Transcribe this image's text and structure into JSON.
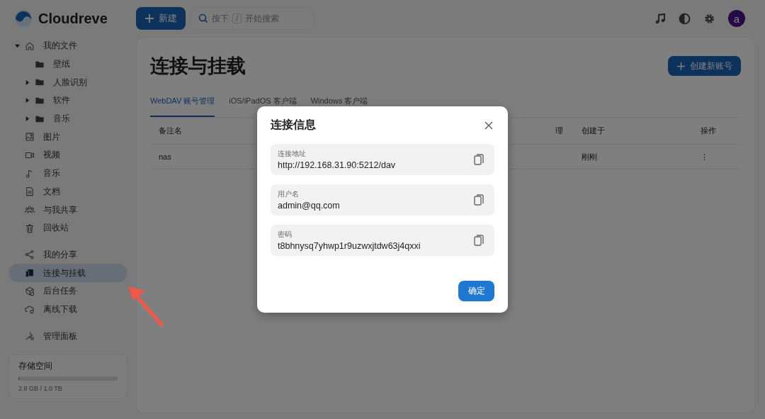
{
  "app": {
    "name": "Cloudreve"
  },
  "topbar": {
    "new_button": "新建",
    "search": {
      "placeholder_before": "按下",
      "key": "/",
      "placeholder_after": "开始搜索"
    },
    "avatar": "a"
  },
  "sidebar": {
    "tree": {
      "label": "我的文件",
      "selected": false,
      "expanded": true,
      "children": [
        {
          "label": "壁纸"
        },
        {
          "label": "人脸识别",
          "expanded": false
        },
        {
          "label": "软件",
          "expanded": false
        },
        {
          "label": "音乐",
          "expanded": false
        }
      ]
    },
    "sections": [
      [
        {
          "label": "图片",
          "selected": false
        },
        {
          "label": "视频",
          "selected": false
        },
        {
          "label": "音乐",
          "selected": false
        },
        {
          "label": "文档",
          "selected": false
        },
        {
          "label": "与我共享",
          "selected": false
        },
        {
          "label": "回收站",
          "selected": false
        }
      ],
      [
        {
          "label": "我的分享",
          "selected": false
        },
        {
          "label": "连接与挂载",
          "selected": true
        },
        {
          "label": "后台任务",
          "selected": false
        },
        {
          "label": "离线下载",
          "selected": false
        }
      ],
      [
        {
          "label": "管理面板",
          "selected": false
        }
      ]
    ],
    "storage": {
      "title": "存储空间",
      "level": 0.003,
      "reading": "2.8 GB / 1.0 TB"
    }
  },
  "page": {
    "title": "连接与挂载",
    "create_button": "创建新账号",
    "tabs": [
      {
        "label": "WebDAV 账号管理",
        "selected": true
      },
      {
        "label": "iOS/iPadOS 客户端",
        "selected": false
      },
      {
        "label": "Windows 客户端",
        "selected": false
      }
    ],
    "table": {
      "columns": [
        "备注名",
        "理",
        "创建于",
        "操作"
      ],
      "rows": [
        {
          "name": "nas",
          "created": "刚刚",
          "actions": "⋮"
        }
      ]
    }
  },
  "dialog": {
    "title": "连接信息",
    "fields": [
      {
        "label": "连接地址",
        "value": "http://192.168.31.90:5212/dav"
      },
      {
        "label": "用户名",
        "value": "admin@qq.com"
      },
      {
        "label": "密码",
        "value": "t8bhnysq7yhwp1r9uzwxjtdw63j4qxxi"
      }
    ],
    "ok_button": "确定"
  }
}
